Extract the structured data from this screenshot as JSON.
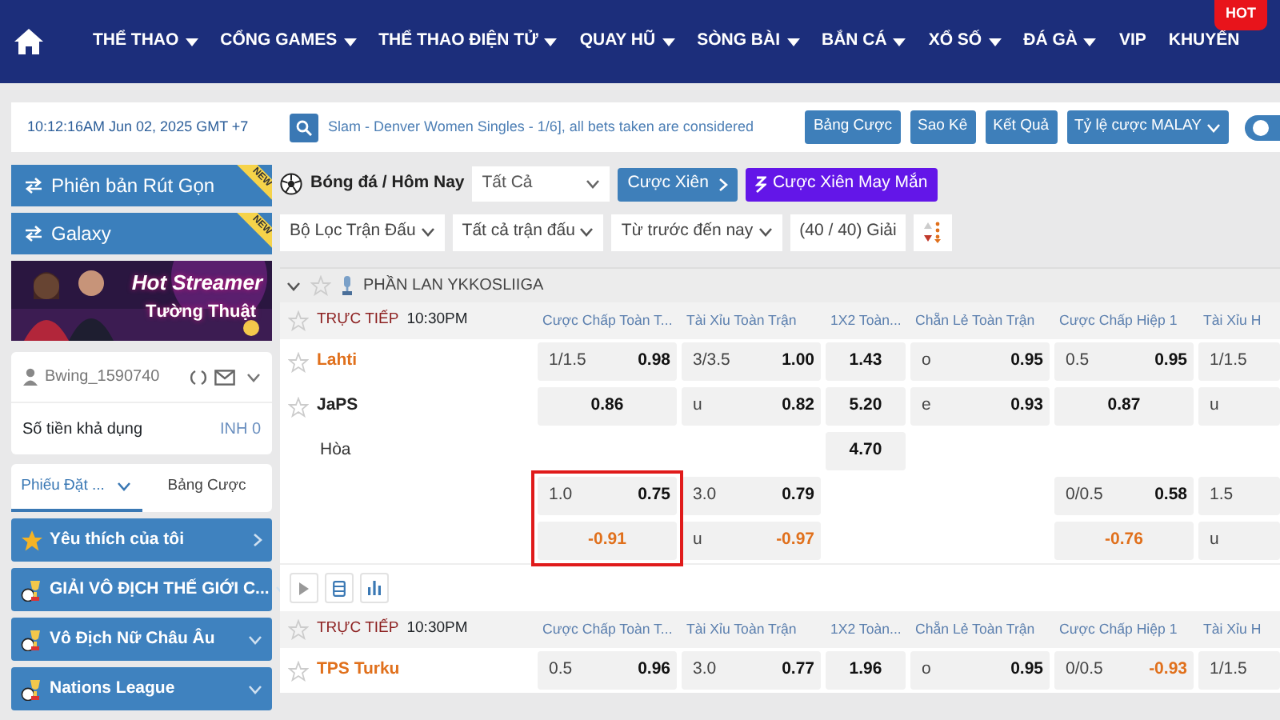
{
  "nav": {
    "items": [
      {
        "label": "THỂ THAO",
        "has_menu": true
      },
      {
        "label": "CỔNG GAMES",
        "has_menu": true
      },
      {
        "label": "THỂ THAO ĐIỆN TỬ",
        "has_menu": true
      },
      {
        "label": "QUAY HŨ",
        "has_menu": true
      },
      {
        "label": "SÒNG BÀI",
        "has_menu": true
      },
      {
        "label": "BẮN CÁ",
        "has_menu": true
      },
      {
        "label": "XỔ SỐ",
        "has_menu": true
      },
      {
        "label": "ĐÁ GÀ",
        "has_menu": true
      },
      {
        "label": "VIP",
        "has_menu": false
      },
      {
        "label": "KHUYẾN",
        "has_menu": false,
        "badge": "HOT"
      }
    ]
  },
  "top_bar": {
    "clock": "10:12:16AM Jun 02, 2025 GMT +7",
    "ticker": "Slam - Denver Women Singles - 1/6], all bets taken are considered",
    "buttons": [
      {
        "label": "Bảng Cược",
        "dropdown": false
      },
      {
        "label": "Sao Kê",
        "dropdown": false
      },
      {
        "label": "Kết Quả",
        "dropdown": false
      },
      {
        "label": "Tỷ lệ cược MALAY",
        "dropdown": true
      }
    ],
    "toggle": {
      "on": true
    }
  },
  "sidebar": {
    "banners": [
      {
        "label": "Phiên bản Rút Gọn",
        "ribbon": "NEW"
      },
      {
        "label": "Galaxy",
        "ribbon": "NEW"
      }
    ],
    "promo": {
      "kind": "picture",
      "title": "Hot Streamer",
      "subtitle": "Tường Thuật"
    },
    "account": {
      "username": "Bwing_1590740",
      "balance_label": "Số tiền khả dụng",
      "balance": "INH 0"
    },
    "tabs": [
      {
        "label": "Phiếu Đặt ...",
        "selected": true,
        "dropdown": true
      },
      {
        "label": "Bảng Cược",
        "selected": false,
        "dropdown": false
      }
    ],
    "sections": [
      {
        "label": "Yêu thích của tôi",
        "kind": "favorites"
      },
      {
        "label": "GIẢI VÔ ĐỊCH THẾ GIỚI C...",
        "kind": "league"
      },
      {
        "label": "Vô Địch Nữ Châu Âu",
        "kind": "league"
      },
      {
        "label": "Nations League",
        "kind": "league"
      }
    ]
  },
  "main": {
    "sport": "Bóng đá / Hôm Nay",
    "period": "Tất Cả",
    "parlay_button": "Cược Xiên",
    "lucky_button": "Cược Xiên May Mắn",
    "filters": [
      {
        "label": "Bộ Lọc Trận Đấu",
        "dropdown": true
      },
      {
        "label": "Tất cả trận đấu",
        "dropdown": true
      },
      {
        "label": "Từ trước đến nay",
        "dropdown": true
      },
      {
        "label": "(40 / 40) Giải",
        "dropdown": false
      }
    ],
    "league": "PHẦN LAN YKKOSLIIGA",
    "matches": [
      {
        "status": "TRỰC TIẾP",
        "time": "10:30PM",
        "tools": true,
        "columns": [
          "Cược Chấp Toàn T...",
          "Tài Xỉu Toàn Trận",
          "1X2 Toàn...",
          "Chẵn Lẻ Toàn Trận",
          "Cược Chấp Hiệp 1",
          "Tài Xỉu H"
        ],
        "rows": [
          {
            "team": "Lahti",
            "kind": "home",
            "cells": [
              {
                "line": "1/1.5",
                "odds": "0.98",
                "negative": false,
                "framed": false
              },
              {
                "line": "3/3.5",
                "odds": "1.00",
                "negative": false,
                "framed": false
              },
              {
                "odds": "1.43",
                "negative": false,
                "framed": false
              },
              {
                "line": "o",
                "odds": "0.95",
                "negative": false,
                "framed": false
              },
              {
                "line": "0.5",
                "odds": "0.95",
                "negative": false,
                "framed": false
              },
              {
                "line": "1/1.5"
              }
            ]
          },
          {
            "team": "JaPS",
            "kind": "away",
            "cells": [
              {
                "odds": "0.86",
                "negative": false,
                "framed": false
              },
              {
                "line": "u",
                "odds": "0.82",
                "negative": false,
                "framed": false
              },
              {
                "odds": "5.20",
                "negative": false,
                "framed": false
              },
              {
                "line": "e",
                "odds": "0.93",
                "negative": false,
                "framed": false
              },
              {
                "odds": "0.87",
                "negative": false,
                "framed": false
              },
              {
                "line": "u"
              }
            ]
          },
          {
            "team": "Hòa",
            "kind": "draw",
            "cells": [
              null,
              null,
              {
                "odds": "4.70",
                "negative": false,
                "framed": false
              },
              null,
              null,
              null
            ]
          },
          {
            "kind": "alt",
            "cells": [
              {
                "line": "1.0",
                "odds": "0.75",
                "negative": false,
                "framed": true
              },
              {
                "line": "3.0",
                "odds": "0.79",
                "negative": false,
                "framed": false
              },
              null,
              null,
              {
                "line": "0/0.5",
                "odds": "0.58",
                "negative": false,
                "framed": false
              },
              {
                "line": "1.5"
              }
            ]
          },
          {
            "kind": "alt",
            "cells": [
              {
                "odds": "-0.91",
                "negative": true,
                "framed": true
              },
              {
                "line": "u",
                "odds": "-0.97",
                "negative": true,
                "framed": false
              },
              null,
              null,
              {
                "odds": "-0.76",
                "negative": true,
                "framed": false
              },
              {
                "line": "u"
              }
            ]
          }
        ]
      },
      {
        "status": "TRỰC TIẾP",
        "time": "10:30PM",
        "columns": [
          "Cược Chấp Toàn T...",
          "Tài Xỉu Toàn Trận",
          "1X2 Toàn...",
          "Chẵn Lẻ Toàn Trận",
          "Cược Chấp Hiệp 1",
          "Tài Xỉu H"
        ],
        "rows": [
          {
            "team": "TPS Turku",
            "kind": "home",
            "cells": [
              {
                "line": "0.5",
                "odds": "0.96",
                "negative": false,
                "framed": false
              },
              {
                "line": "3.0",
                "odds": "0.77",
                "negative": false,
                "framed": false
              },
              {
                "odds": "1.96",
                "negative": false,
                "framed": false
              },
              {
                "line": "o",
                "odds": "0.95",
                "negative": false,
                "framed": false
              },
              {
                "line": "0/0.5",
                "odds": "-0.93",
                "negative": true,
                "framed": false
              },
              {
                "line": "1/1.5"
              }
            ]
          }
        ]
      }
    ]
  }
}
